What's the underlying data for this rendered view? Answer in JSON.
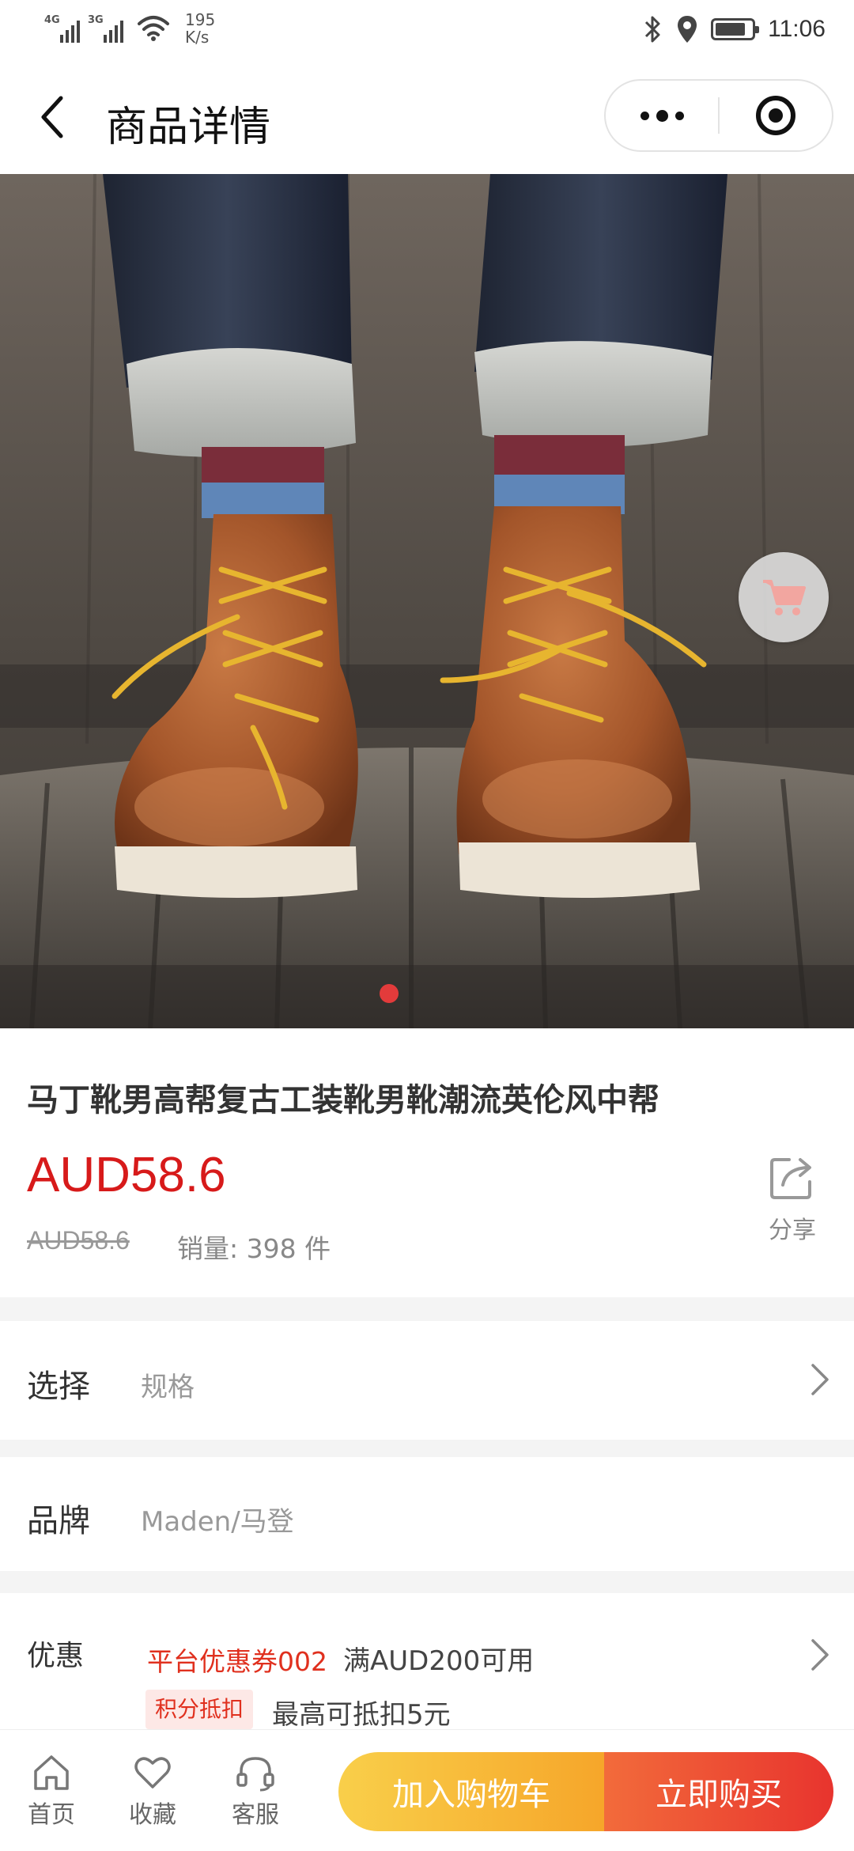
{
  "status_bar": {
    "signal1": "4G",
    "signal2": "3G",
    "speed_value": "195",
    "speed_unit": "K/s",
    "time": "11:06",
    "battery_percent": 85
  },
  "nav": {
    "title": "商品详情"
  },
  "product": {
    "title": "马丁靴男高帮复古工装靴男靴潮流英伦风中帮",
    "price": "AUD58.6",
    "original_price": "AUD58.6",
    "sales": "销量: 398 件",
    "share_label": "分享",
    "image_index": 1,
    "image_count": 1
  },
  "select_row": {
    "label": "选择",
    "value": "规格"
  },
  "brand_row": {
    "label": "品牌",
    "value": "Maden/马登"
  },
  "promo_row": {
    "label": "优惠",
    "coupon_name": "平台优惠券002",
    "coupon_condition": "满AUD200可用",
    "points_tag": "积分抵扣",
    "points_text": "最高可抵扣5元"
  },
  "bottom_bar": {
    "home_label": "首页",
    "favorite_label": "收藏",
    "service_label": "客服",
    "add_to_cart_label": "加入购物车",
    "buy_now_label": "立即购买"
  },
  "colors": {
    "price_red": "#d71a1a",
    "coupon_red": "#e0301e",
    "cart_btn_yellow": "#f6a62a",
    "buy_btn_red": "#e8342e"
  }
}
